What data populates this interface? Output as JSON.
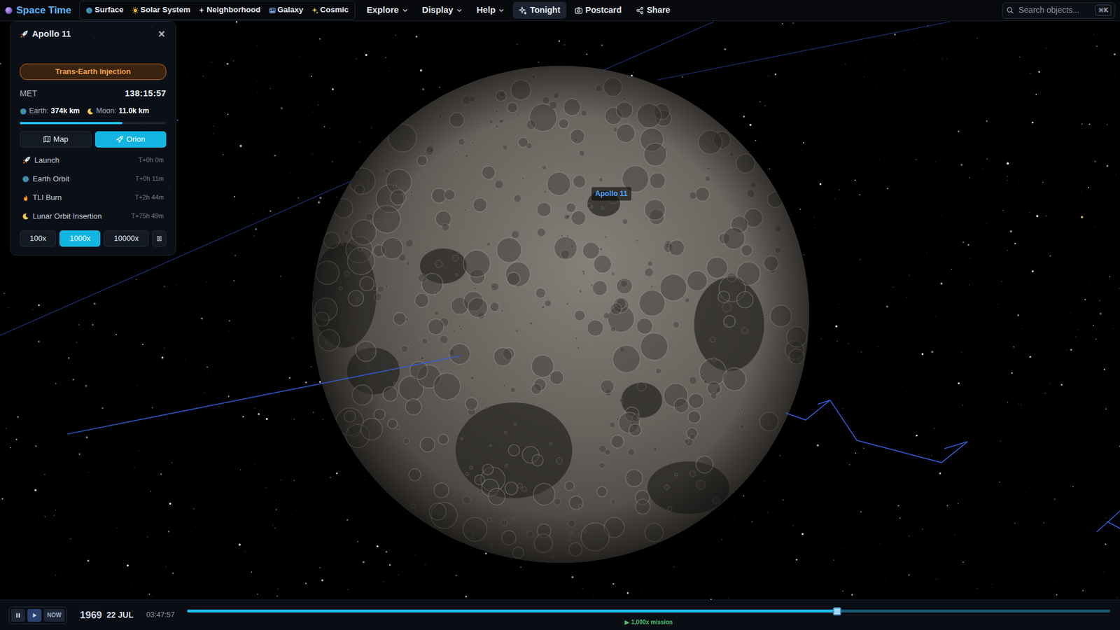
{
  "nav": {
    "logo": "Space Time",
    "tabs": [
      {
        "label": "Surface",
        "selected": false
      },
      {
        "label": "Solar System",
        "selected": false
      },
      {
        "label": "Neighborhood",
        "selected": false
      },
      {
        "label": "Galaxy",
        "selected": false
      },
      {
        "label": "Cosmic",
        "selected": false
      }
    ],
    "menus": [
      "Explore",
      "Display",
      "Help"
    ],
    "actions": [
      {
        "label": "Tonight",
        "selected": true
      },
      {
        "label": "Postcard",
        "selected": false
      },
      {
        "label": "Share",
        "selected": false
      }
    ],
    "search": {
      "placeholder": "Search objects...",
      "shortcut": "⌘K"
    }
  },
  "mission": {
    "title": "Apollo 11",
    "close": "×",
    "phase": "Trans-Earth Injection",
    "met": {
      "label": "MET",
      "value": "138:15:57"
    },
    "distances": [
      {
        "label": "Earth:",
        "value": "374k km"
      },
      {
        "label": "Moon:",
        "value": "11.0k km"
      }
    ],
    "progress": {
      "level": 0.7
    },
    "views": [
      {
        "label": "Map",
        "selected": false
      },
      {
        "label": "Orion",
        "selected": true
      }
    ],
    "events": [
      {
        "label": "Launch",
        "time": "T+0h 0m"
      },
      {
        "label": "Earth Orbit",
        "time": "T+0h 11m"
      },
      {
        "label": "TLI Burn",
        "time": "T+2h 44m"
      },
      {
        "label": "Lunar Orbit Insertion",
        "time": "T+75h 49m"
      }
    ],
    "speeds": [
      {
        "label": "100x",
        "selected": false
      },
      {
        "label": "1000x",
        "selected": true
      },
      {
        "label": "10000x",
        "selected": false
      }
    ]
  },
  "scene": {
    "label": "Apollo 11"
  },
  "timebar": {
    "controls": [
      {
        "kind": "pause",
        "label": "",
        "selected": false
      },
      {
        "kind": "play",
        "label": "",
        "selected": true
      },
      {
        "kind": "now",
        "label": "NOW",
        "selected": false
      }
    ],
    "year": "1969",
    "day": "22 JUL",
    "time": "03:47:57",
    "timeline": {
      "level": 0.704,
      "caption": "▶ 1,000x mission"
    }
  }
}
